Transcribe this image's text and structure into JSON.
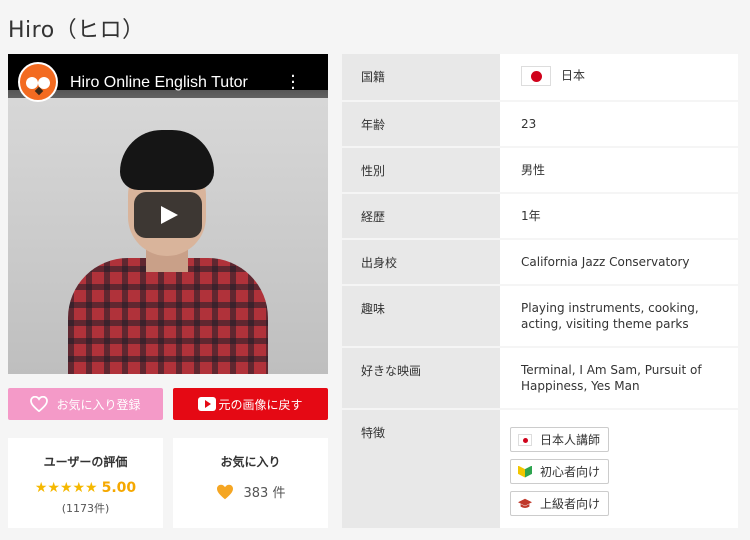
{
  "page_title": "Hiro（ヒロ）",
  "video": {
    "title": "Hiro Online English Tutor",
    "channel_icon": "owl-logo-icon",
    "menu_icon": "more-vert-icon",
    "play_icon": "play-icon"
  },
  "buttons": {
    "favorite_label": "お気に入り登録",
    "favorite_icon": "heart-icon",
    "back_label": "元の画像に戻す",
    "back_icon": "youtube-icon"
  },
  "rating_card": {
    "label": "ユーザーの評価",
    "stars": "★★★★★",
    "score": "5.00",
    "count": "(1173件)"
  },
  "favorites_card": {
    "label": "お気に入り",
    "icon": "heart-icon",
    "count": "383 件"
  },
  "profile": {
    "nationality_label": "国籍",
    "nationality_value": "日本",
    "age_label": "年齢",
    "age_value": "23",
    "gender_label": "性別",
    "gender_value": "男性",
    "experience_label": "経歴",
    "experience_value": "1年",
    "school_label": "出身校",
    "school_value": "California Jazz Conservatory",
    "hobby_label": "趣味",
    "hobby_value": "Playing instruments, cooking, acting, visiting theme parks",
    "movie_label": "好きな映画",
    "movie_value": "Terminal, I Am Sam, Pursuit of Happiness, Yes Man",
    "features_label": "特徴",
    "features": [
      {
        "label": "日本人講師",
        "icon": "japan-flag-icon"
      },
      {
        "label": "初心者向け",
        "icon": "beginner-mark-icon"
      },
      {
        "label": "上級者向け",
        "icon": "graduation-cap-icon"
      }
    ]
  },
  "colors": {
    "favorite_button": "#f49ac8",
    "youtube_button": "#e50914",
    "star": "#f5b800",
    "heart": "#f5a623"
  }
}
